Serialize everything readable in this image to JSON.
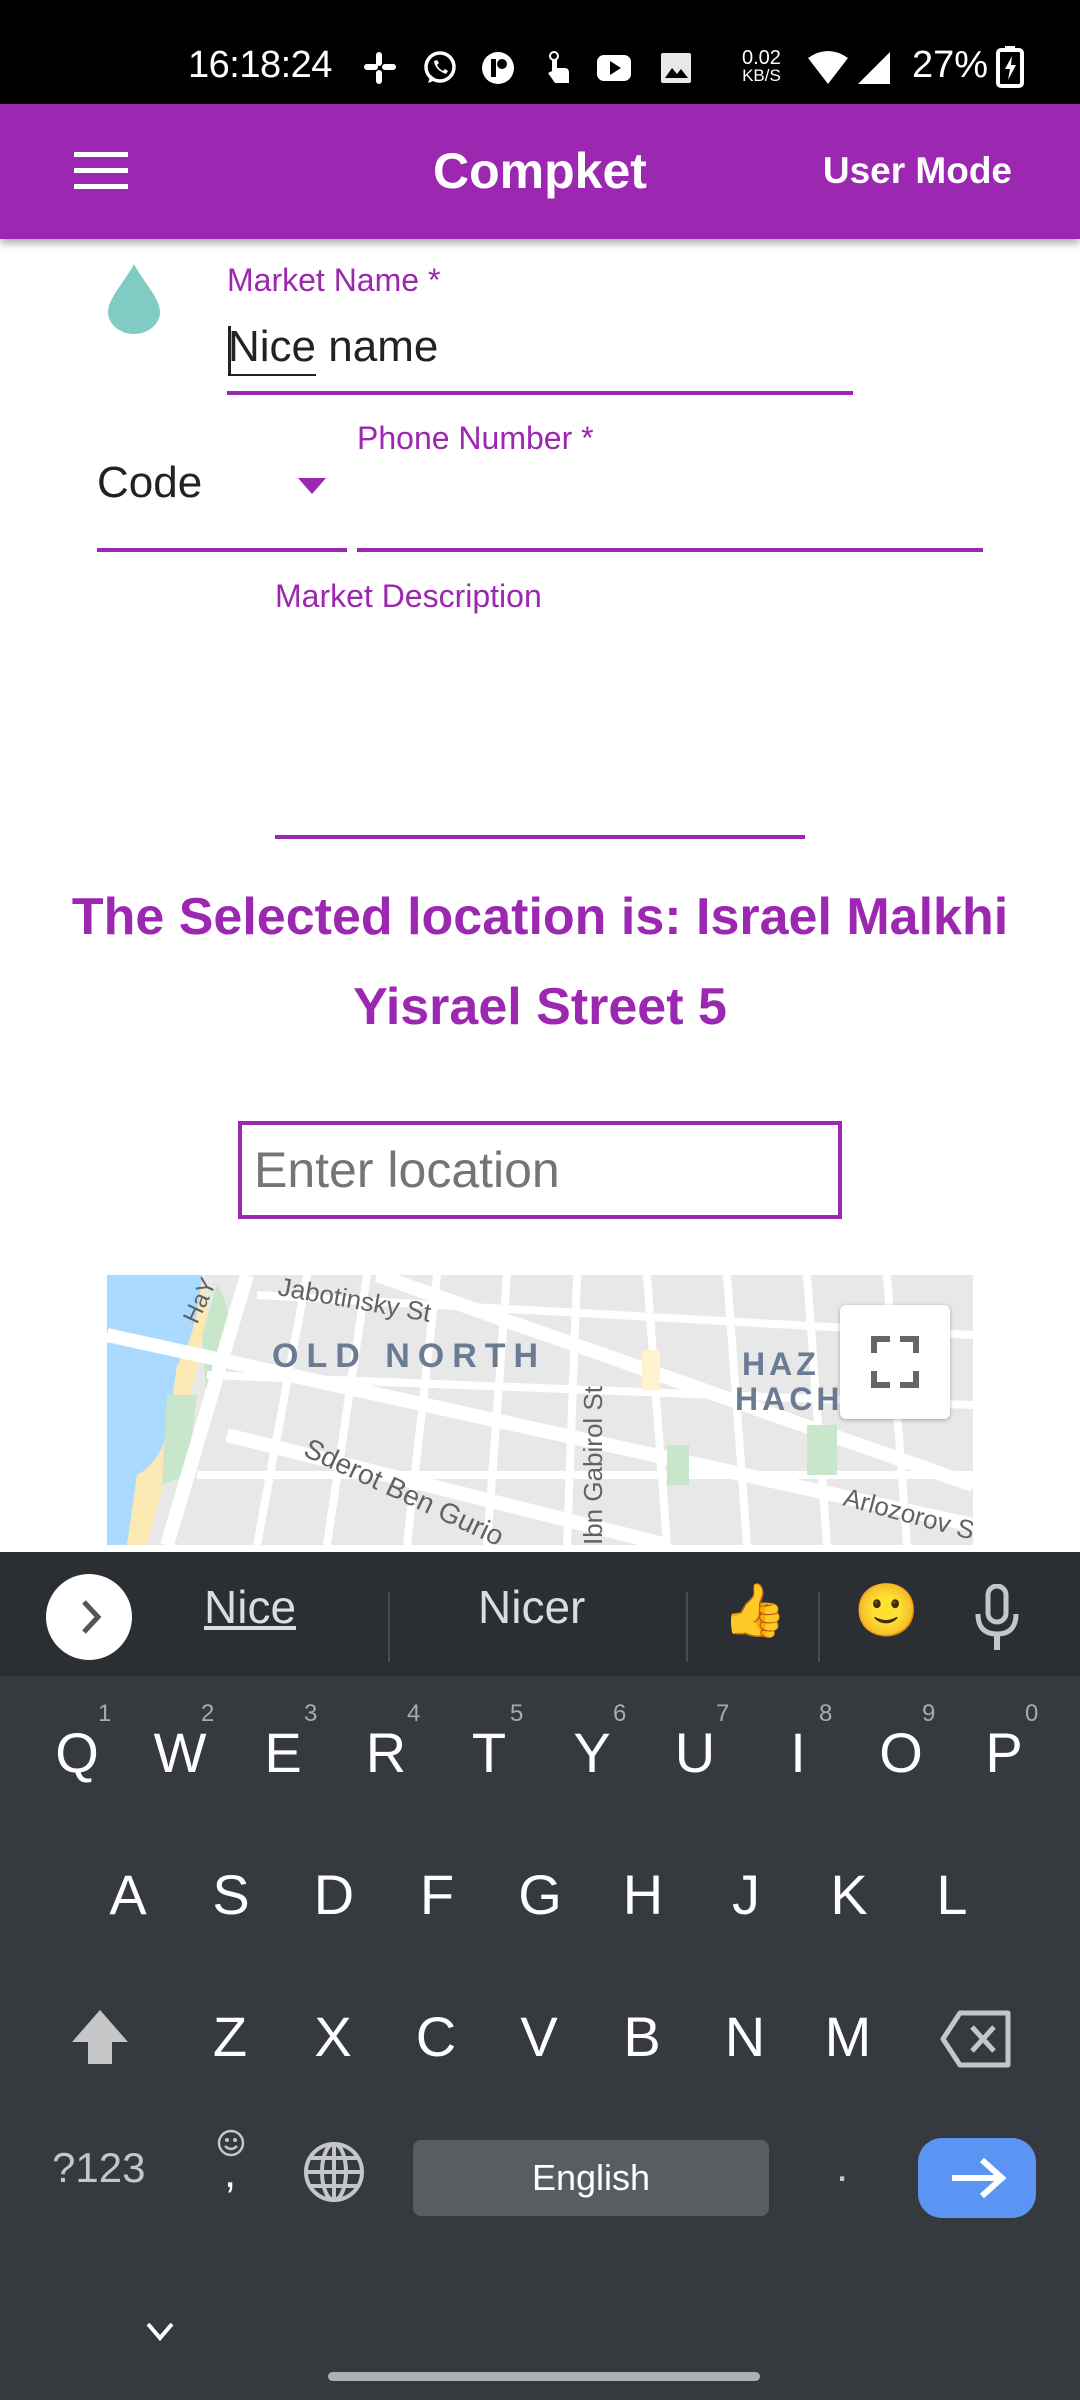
{
  "status_bar": {
    "time": "16:18:24",
    "notification_icons": [
      "slack-icon",
      "whatsapp-icon",
      "pinterest-like-icon",
      "touch-icon",
      "youtube-icon",
      "gallery-icon"
    ],
    "net_speed_value": "0.02",
    "net_speed_unit": "KB/S",
    "battery_percent": "27%"
  },
  "app_bar": {
    "title": "Compket",
    "user_mode_label": "User Mode"
  },
  "form": {
    "market_name_label": "Market Name *",
    "market_name_value": "Nice name",
    "code_value": "Code",
    "phone_label": "Phone Number *",
    "phone_value": "",
    "description_label": "Market Description",
    "description_value": ""
  },
  "selected_location": {
    "line1": "The Selected location is: Israel Malkhi",
    "line2": "Yisrael Street 5"
  },
  "location_search": {
    "placeholder": "Enter location",
    "value": ""
  },
  "map": {
    "labels": {
      "old_north": "OLD NORTH",
      "jabotinsky": "Jabotinsky St",
      "hayarkon": "HaY",
      "ibn_gabirol": "Ibn Gabirol St",
      "ben_gurion": "Sderot Ben Gurio",
      "arlozorov": "Arlozorov S",
      "hazafon_1": "HAZ",
      "hazafon_2": "HACH"
    }
  },
  "keyboard": {
    "suggestions": [
      "Nice",
      "Nicer"
    ],
    "emoji_suggestions": [
      "👍",
      "🙂"
    ],
    "row1": [
      {
        "key": "Q",
        "hint": "1"
      },
      {
        "key": "W",
        "hint": "2"
      },
      {
        "key": "E",
        "hint": "3"
      },
      {
        "key": "R",
        "hint": "4"
      },
      {
        "key": "T",
        "hint": "5"
      },
      {
        "key": "Y",
        "hint": "6"
      },
      {
        "key": "U",
        "hint": "7"
      },
      {
        "key": "I",
        "hint": "8"
      },
      {
        "key": "O",
        "hint": "9"
      },
      {
        "key": "P",
        "hint": "0"
      }
    ],
    "row2": [
      "A",
      "S",
      "D",
      "F",
      "G",
      "H",
      "J",
      "K",
      "L"
    ],
    "row3": [
      "Z",
      "X",
      "C",
      "V",
      "B",
      "N",
      "M"
    ],
    "symbols_label": "?123",
    "comma_label": ",",
    "space_label": "English",
    "period_label": "."
  },
  "colors": {
    "accent": "#9c27b0",
    "keyboard_bg": "#363a3f",
    "enter_key": "#5b94f2",
    "drop_icon": "#80cbc4"
  }
}
